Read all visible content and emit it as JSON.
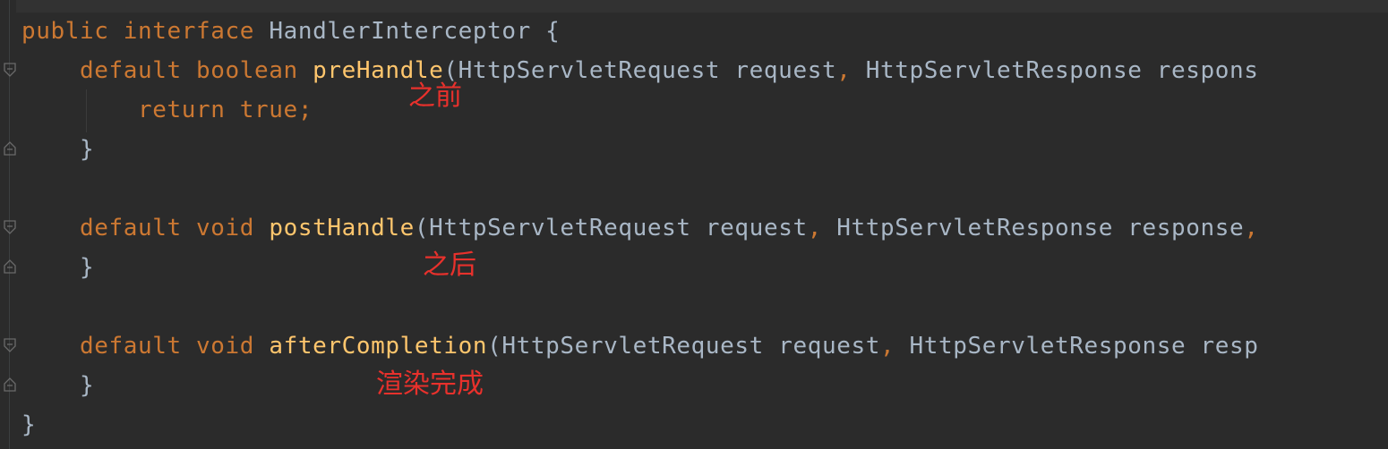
{
  "code": {
    "lines": [
      {
        "tokens": [
          {
            "text": "public ",
            "kind": "kw"
          },
          {
            "text": "interface ",
            "kind": "kw"
          },
          {
            "text": "HandlerInterceptor {",
            "kind": "plain"
          }
        ]
      },
      {
        "tokens": [
          {
            "text": "    default boolean ",
            "kind": "kw"
          },
          {
            "text": "preHandle",
            "kind": "fn"
          },
          {
            "text": "(HttpServletRequest request",
            "kind": "plain"
          },
          {
            "text": ", ",
            "kind": "punct"
          },
          {
            "text": "HttpServletResponse respons",
            "kind": "plain"
          }
        ]
      },
      {
        "tokens": [
          {
            "text": "        return true;",
            "kind": "kw"
          }
        ]
      },
      {
        "tokens": [
          {
            "text": "    }",
            "kind": "plain"
          }
        ]
      },
      {
        "tokens": []
      },
      {
        "tokens": [
          {
            "text": "    default void ",
            "kind": "kw"
          },
          {
            "text": "postHandle",
            "kind": "fn"
          },
          {
            "text": "(HttpServletRequest request",
            "kind": "plain"
          },
          {
            "text": ", ",
            "kind": "punct"
          },
          {
            "text": "HttpServletResponse response",
            "kind": "plain"
          },
          {
            "text": ",",
            "kind": "punct"
          }
        ]
      },
      {
        "tokens": [
          {
            "text": "    }",
            "kind": "plain"
          }
        ]
      },
      {
        "tokens": []
      },
      {
        "tokens": [
          {
            "text": "    default void ",
            "kind": "kw"
          },
          {
            "text": "afterCompletion",
            "kind": "fn"
          },
          {
            "text": "(HttpServletRequest request",
            "kind": "plain"
          },
          {
            "text": ", ",
            "kind": "punct"
          },
          {
            "text": "HttpServletResponse resp",
            "kind": "plain"
          }
        ]
      },
      {
        "tokens": [
          {
            "text": "    }",
            "kind": "plain"
          }
        ]
      },
      {
        "tokens": [
          {
            "text": "}",
            "kind": "plain"
          }
        ]
      }
    ]
  },
  "annotations": {
    "pre": "之前",
    "post": "之后",
    "after": "渲染完成"
  },
  "colors": {
    "background": "#2b2b2b",
    "keyword": "#cc7832",
    "method": "#ffc66d",
    "text": "#a9b7c6",
    "annotation": "#e8312c"
  }
}
